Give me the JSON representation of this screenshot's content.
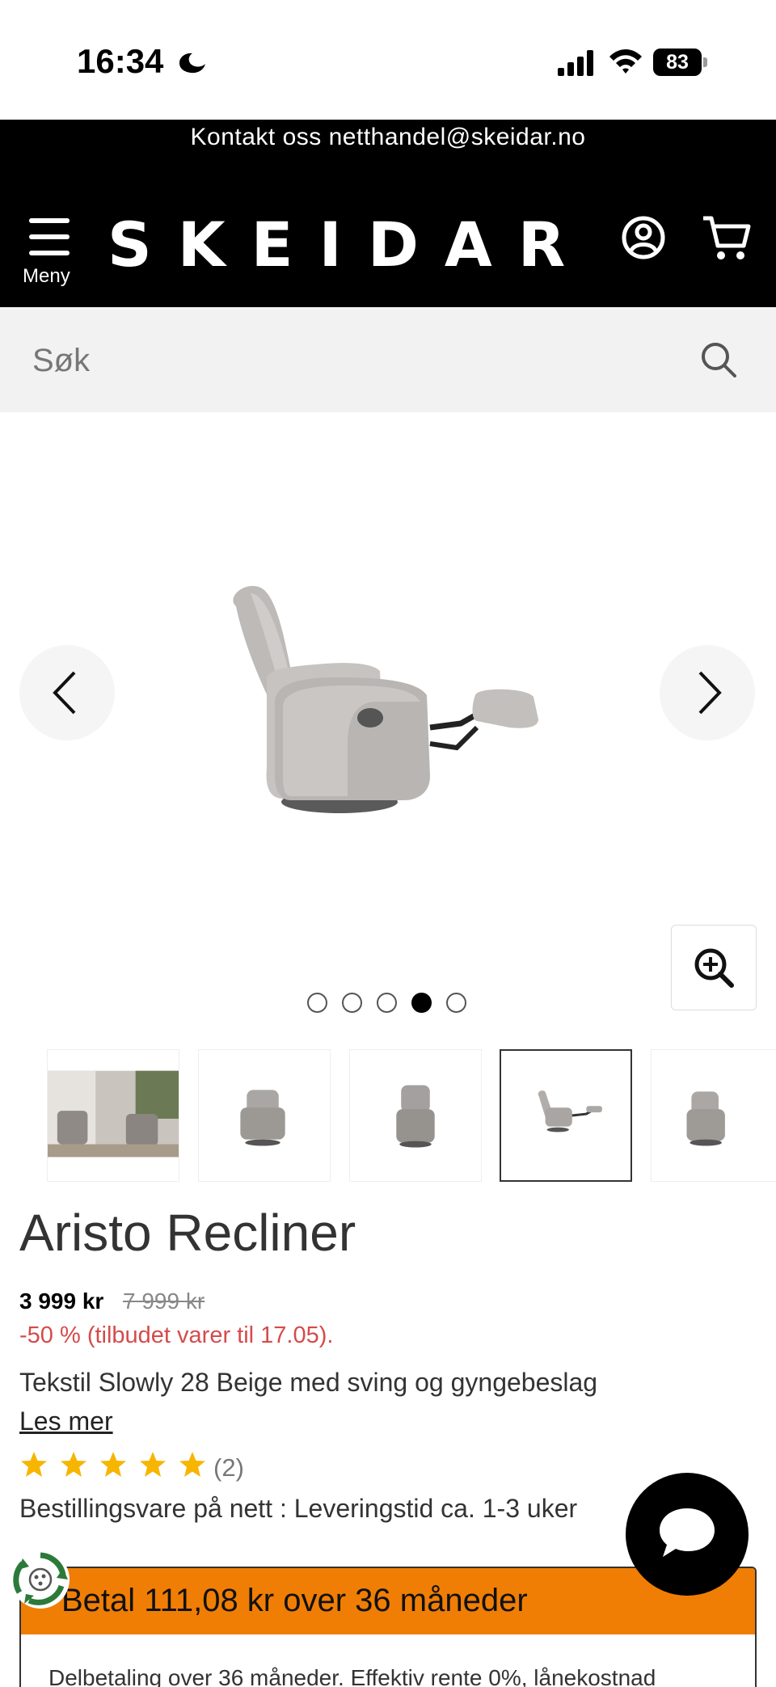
{
  "status_bar": {
    "time": "16:34",
    "battery": "83"
  },
  "header": {
    "contact_text": "Kontakt oss netthandel@skeidar.no",
    "menu_label": "Meny",
    "logo_text": "SKEIDAR"
  },
  "search": {
    "placeholder": "Søk"
  },
  "gallery": {
    "image_count": 5,
    "active_index": 3,
    "thumbnails": [
      "interior-scene",
      "recliner-front",
      "recliner-front-upright",
      "recliner-side-reclined",
      "recliner-angle"
    ]
  },
  "product": {
    "title": "Aristo Recliner",
    "price": "3 999 kr",
    "old_price": "7 999 kr",
    "discount": "-50 % (tilbudet varer til 17.05).",
    "variant": "Tekstil Slowly 28 Beige med sving og gyngebeslag",
    "read_more": "Les mer",
    "rating": 5,
    "rating_count": "(2)",
    "delivery": "Bestillingsvare på nett : Leveringstid ca. 1-3 uker"
  },
  "finance": {
    "title": "Betal 111,08 kr over 36 måneder",
    "body": "Delbetaling over 36 måneder. Effektiv rente 0%, lånekostnad"
  },
  "colors": {
    "accent_orange": "#f07e05",
    "discount_red": "#d54b4b",
    "star_yellow": "#f7b500"
  },
  "icons": [
    "moon-icon",
    "signal-icon",
    "wifi-icon",
    "menu-icon",
    "account-icon",
    "cart-icon",
    "search-icon",
    "chevron-left-icon",
    "chevron-right-icon",
    "zoom-in-icon",
    "star-icon",
    "recycle-icon",
    "chat-icon"
  ]
}
